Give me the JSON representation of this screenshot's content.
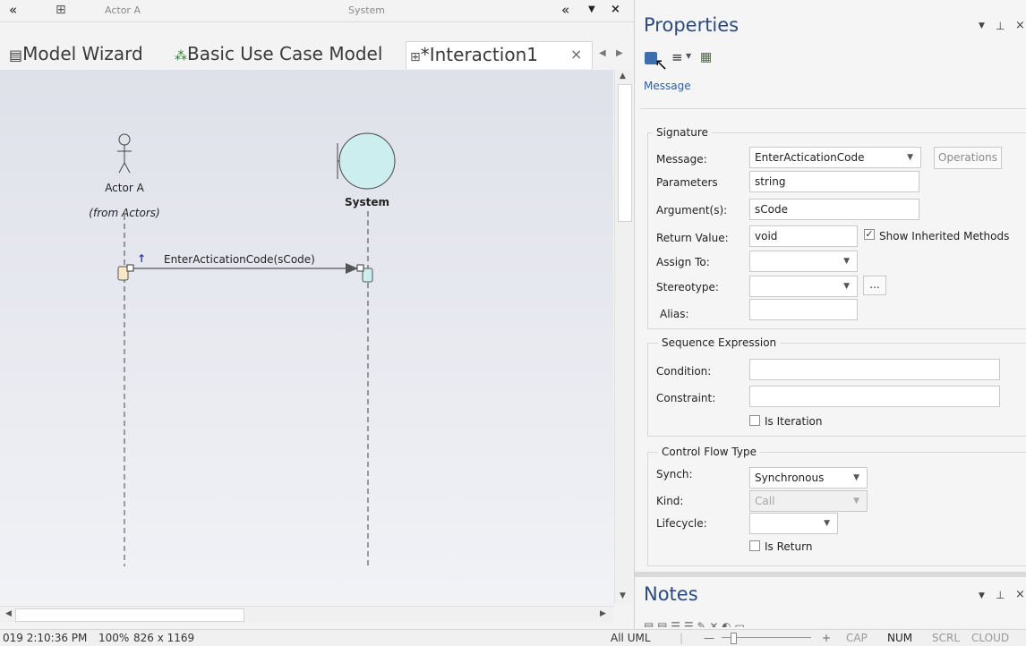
{
  "diagram_header": {
    "actor_label": "Actor A",
    "system_label": "System"
  },
  "tabs": [
    {
      "label": "Model Wizard"
    },
    {
      "label": "Basic Use Case Model"
    },
    {
      "label": "*Interaction1"
    }
  ],
  "diagram": {
    "actor_name": "Actor A",
    "actor_from": "(from Actors)",
    "system_name": "System",
    "message": "EnterActicationCode(sCode)"
  },
  "status": {
    "time": "019 2:10:36 PM",
    "zoom": "100%",
    "size": "826 x 1169",
    "mode": "All UML",
    "cap": "CAP",
    "num": "NUM",
    "scrl": "SCRL",
    "cloud": "CLOUD"
  },
  "properties": {
    "title": "Properties",
    "section": "Message",
    "signature": {
      "group": "Signature",
      "message_label": "Message:",
      "message_value": "EnterActicationCode",
      "operations_btn": "Operations",
      "parameters_label": "Parameters",
      "parameters_value": "string",
      "arguments_label": "Argument(s):",
      "arguments_value": "sCode",
      "return_label": "Return Value:",
      "return_value": "void",
      "show_inherited": "Show Inherited Methods",
      "assign_label": "Assign To:",
      "stereotype_label": "Stereotype:",
      "ellipsis": "...",
      "alias_label": "Alias:"
    },
    "sequence": {
      "group": "Sequence Expression",
      "condition_label": "Condition:",
      "constraint_label": "Constraint:",
      "is_iteration": "Is Iteration"
    },
    "control_flow": {
      "group": "Control Flow Type",
      "synch_label": "Synch:",
      "synch_value": "Synchronous",
      "kind_label": "Kind:",
      "kind_value": "Call",
      "lifecycle_label": "Lifecycle:",
      "is_return": "Is Return"
    }
  },
  "notes": {
    "title": "Notes"
  },
  "colors": {
    "accent": "#2b5fa6",
    "canvas_top": "#dfe1ea",
    "system_fill": "#cdeeee"
  }
}
